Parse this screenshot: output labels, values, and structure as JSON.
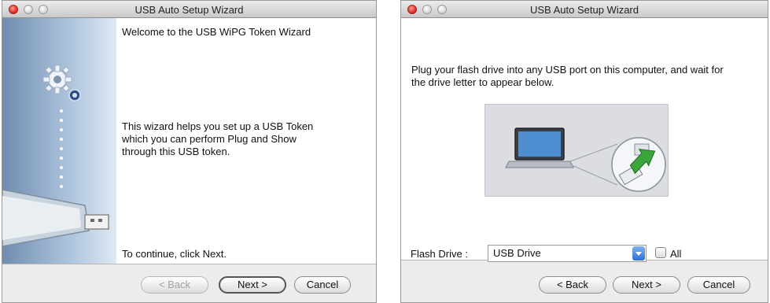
{
  "left_window": {
    "title": "USB Auto Setup Wizard",
    "welcome_heading": "Welcome to the USB WiPG Token Wizard",
    "description_line1": "This wizard helps you set up a USB Token",
    "description_line2": "which you can perform Plug and Show",
    "description_line3": "through this USB token.",
    "continue_text": "To continue, click Next.",
    "buttons": {
      "back": "< Back",
      "next": "Next >",
      "cancel": "Cancel"
    }
  },
  "right_window": {
    "title": "USB Auto Setup Wizard",
    "instruction_line1": "Plug your flash drive into any USB port on this computer, and wait for",
    "instruction_line2": "the drive letter to appear below.",
    "flash_drive_label": "Flash Drive :",
    "flash_drive_selected": "USB Drive",
    "all_checkbox_label": "All",
    "buttons": {
      "back": "< Back",
      "next": "Next >",
      "cancel": "Cancel"
    }
  },
  "colors": {
    "close_button": "#e2302a",
    "sidebar_blue": "#6f8db0",
    "arrow_green": "#3aa53a",
    "dropdown_arrow": "#2f6fd6"
  },
  "icons": [
    "gear-icon",
    "usb-stick-icon",
    "laptop-icon",
    "usb-port-icon",
    "arrow-icon",
    "chevron-down-icon"
  ]
}
